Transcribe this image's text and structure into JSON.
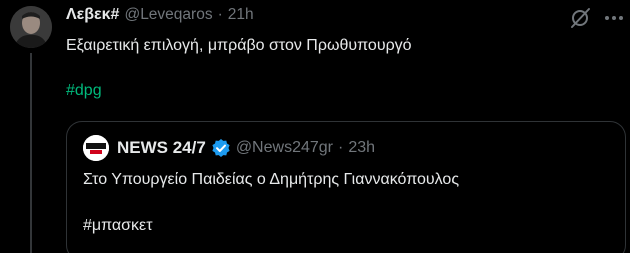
{
  "tweet": {
    "author": {
      "display_name": "Λεβεκ#",
      "handle": "@Leveqaros",
      "separator": "·",
      "time": "21h",
      "avatar_icon": "user-avatar"
    },
    "text": "Εξαιρετική επιλογή, μπράβο στον Πρωθυπουργό",
    "hashtag": "#dpg",
    "hashtag_color": "#00ba7c",
    "icons": {
      "action": "grok-slash-icon",
      "more": "more-icon"
    }
  },
  "quoted_tweet": {
    "author": {
      "display_name": "NEWS 24/7",
      "handle": "@News247gr",
      "separator": "·",
      "time": "23h",
      "avatar_label": "NEWS 24/7",
      "verified": true,
      "verified_color": "#1d9bf0"
    },
    "text": "Στο Υπουργείο Παιδείας ο Δημήτρης Γιαννακόπουλος",
    "hashtag": "#μπασκετ"
  },
  "colors": {
    "background": "#000000",
    "text": "#e7e9ea",
    "muted": "#71767b",
    "border": "#2f3336"
  }
}
